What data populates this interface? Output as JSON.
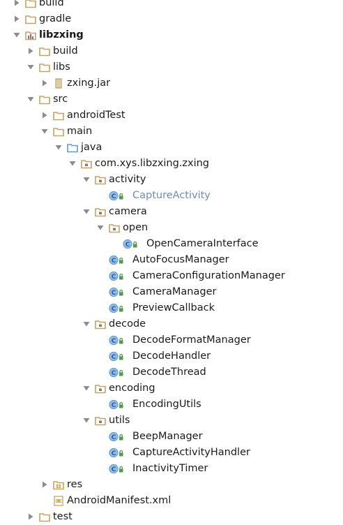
{
  "tree": {
    "items": [
      {
        "label": "build",
        "icon": "folder-icon",
        "expanded": false,
        "has_children": true
      },
      {
        "label": "gradle",
        "icon": "folder-icon",
        "expanded": false,
        "has_children": true
      },
      {
        "label": "libzxing",
        "icon": "module-icon",
        "expanded": true,
        "has_children": true,
        "bold": true
      },
      {
        "label": "build",
        "icon": "folder-icon",
        "expanded": false,
        "has_children": true
      },
      {
        "label": "libs",
        "icon": "folder-icon",
        "expanded": true,
        "has_children": true
      },
      {
        "label": "zxing.jar",
        "icon": "jar-icon",
        "expanded": false,
        "has_children": true
      },
      {
        "label": "src",
        "icon": "folder-icon",
        "expanded": true,
        "has_children": true
      },
      {
        "label": "androidTest",
        "icon": "folder-icon",
        "expanded": false,
        "has_children": true
      },
      {
        "label": "main",
        "icon": "folder-icon",
        "expanded": true,
        "has_children": true
      },
      {
        "label": "java",
        "icon": "source-folder-icon",
        "expanded": true,
        "has_children": true
      },
      {
        "label": "com.xys.libzxing.zxing",
        "icon": "package-icon",
        "expanded": true,
        "has_children": true
      },
      {
        "label": "activity",
        "icon": "package-icon",
        "expanded": true,
        "has_children": true
      },
      {
        "label": "CaptureActivity",
        "icon": "class-icon",
        "has_children": false,
        "muted": true
      },
      {
        "label": "camera",
        "icon": "package-icon",
        "expanded": true,
        "has_children": true
      },
      {
        "label": "open",
        "icon": "package-icon",
        "expanded": true,
        "has_children": true
      },
      {
        "label": "OpenCameraInterface",
        "icon": "class-icon",
        "has_children": false
      },
      {
        "label": "AutoFocusManager",
        "icon": "class-icon",
        "has_children": false
      },
      {
        "label": "CameraConfigurationManager",
        "icon": "class-icon",
        "has_children": false
      },
      {
        "label": "CameraManager",
        "icon": "class-icon",
        "has_children": false
      },
      {
        "label": "PreviewCallback",
        "icon": "class-icon",
        "has_children": false
      },
      {
        "label": "decode",
        "icon": "package-icon",
        "expanded": true,
        "has_children": true
      },
      {
        "label": "DecodeFormatManager",
        "icon": "class-icon",
        "has_children": false
      },
      {
        "label": "DecodeHandler",
        "icon": "class-icon",
        "has_children": false
      },
      {
        "label": "DecodeThread",
        "icon": "class-icon",
        "has_children": false
      },
      {
        "label": "encoding",
        "icon": "package-icon",
        "expanded": true,
        "has_children": true
      },
      {
        "label": "EncodingUtils",
        "icon": "class-icon",
        "has_children": false
      },
      {
        "label": "utils",
        "icon": "package-icon",
        "expanded": true,
        "has_children": true
      },
      {
        "label": "BeepManager",
        "icon": "class-icon",
        "has_children": false
      },
      {
        "label": "CaptureActivityHandler",
        "icon": "class-icon",
        "has_children": false
      },
      {
        "label": "InactivityTimer",
        "icon": "class-icon",
        "has_children": false
      },
      {
        "label": "res",
        "icon": "resource-folder-icon",
        "expanded": false,
        "has_children": true
      },
      {
        "label": "AndroidManifest.xml",
        "icon": "xml-file-icon",
        "has_children": false
      },
      {
        "label": "test",
        "icon": "folder-icon",
        "expanded": false,
        "has_children": true
      }
    ]
  },
  "colors": {
    "folder": "#c7a266",
    "package_folder": "#c7a266",
    "java_folder": "#5a9fd4",
    "class_circle": "#8fbbe8",
    "class_letter": "#2a5f95",
    "lock": "#4e9a4e",
    "arrow": "#8c8c8c",
    "muted_text": "#6f8fb0"
  }
}
